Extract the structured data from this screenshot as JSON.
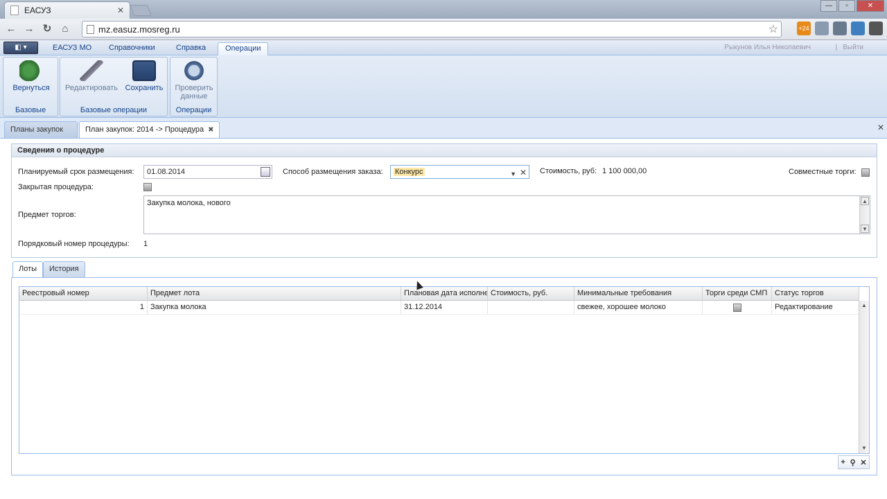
{
  "browser": {
    "tab_title": "ЕАСУЗ",
    "tab_close": "✕",
    "url": "mz.easuz.mosreg.ru",
    "star": "☆",
    "badge": "+24",
    "win_min": "—",
    "win_max": "▫",
    "win_close": "✕"
  },
  "app_menu": {
    "app_button": "◧ ▾",
    "tabs": [
      {
        "label": "ЕАСУЗ МО"
      },
      {
        "label": "Справочники"
      },
      {
        "label": "Справка"
      },
      {
        "label": "Операции"
      }
    ],
    "user": "Рыкунов Илья Николаевич",
    "separator": "|",
    "exit": "Выйти"
  },
  "ribbon": {
    "groups": [
      {
        "label": "Базовые",
        "buttons": [
          {
            "label": "Вернуться",
            "icon": "back-arrow-icon"
          }
        ]
      },
      {
        "label": "Базовые операции",
        "buttons": [
          {
            "label": "Редактировать",
            "icon": "pencil-icon"
          },
          {
            "label": "Сохранить",
            "icon": "floppy-disk-icon"
          }
        ]
      },
      {
        "label": "Операции",
        "buttons": [
          {
            "label": "Проверить данные",
            "icon": "check-globe-icon"
          }
        ]
      }
    ]
  },
  "doc_tabs": {
    "tabs": [
      {
        "label": "Планы закупок"
      },
      {
        "label": "План закупок: 2014 -> Процедура"
      }
    ],
    "close_glyph": "✖",
    "close_all": "✕"
  },
  "procedure": {
    "section_title": "Сведения о процедуре",
    "planned_date_label": "Планируемый срок размещения:",
    "planned_date_value": "01.08.2014",
    "order_method_label": "Способ размещения заказа:",
    "order_method_value": "Конкурс",
    "cost_label": "Стоимость, руб:",
    "cost_value": "1 100 000,00",
    "joint_label": "Совместные торги:",
    "closed_label": "Закрытая процедура:",
    "subject_label": "Предмет торгов:",
    "subject_value": "Закупка молока, нового",
    "number_label": "Порядковый номер процедуры:",
    "number_value": "1"
  },
  "sub_tabs": [
    {
      "label": "Лоты"
    },
    {
      "label": "История"
    }
  ],
  "lots_grid": {
    "columns": [
      "Реестровый номер",
      "Предмет лота",
      "Плановая дата исполнения",
      "Стоимость, руб.",
      "Минимальные требования",
      "Торги среди СМП",
      "Статус торгов"
    ],
    "rows": [
      {
        "reg_number": "1",
        "subject": "Закупка молока",
        "date": "31.12.2014",
        "cost": "",
        "requirements": "свежее, хорошее молоко",
        "status": "Редактирование"
      }
    ],
    "tools": {
      "add": "+",
      "search": "⚲",
      "delete": "✕"
    }
  },
  "colors": {
    "accent": "#15428b",
    "border": "#99bbe8",
    "highlight": "#ffe8a6"
  }
}
